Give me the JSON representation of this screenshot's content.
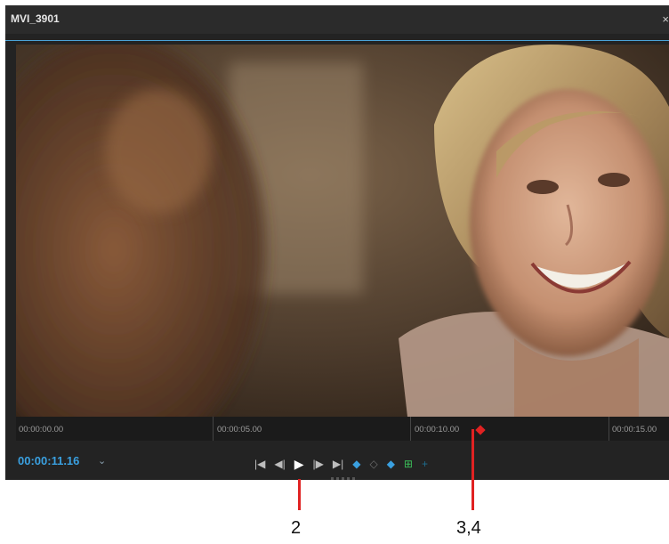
{
  "window": {
    "title": "MVI_3901",
    "close_glyph": "×"
  },
  "timeline": {
    "timecodes": [
      "00:00:00.00",
      "00:00:05.00",
      "00:00:10.00",
      "00:00:15.00"
    ],
    "playhead_color": "#e02222"
  },
  "transport": {
    "current_timecode": "00:00:11.16",
    "timecode_menu_glyph": "⌄",
    "buttons": [
      {
        "name": "go-to-in-icon",
        "glyph": "|◀"
      },
      {
        "name": "step-back-icon",
        "glyph": "◀|"
      },
      {
        "name": "play-icon",
        "glyph": "▶"
      },
      {
        "name": "step-forward-icon",
        "glyph": "|▶"
      },
      {
        "name": "go-to-out-icon",
        "glyph": "▶|"
      },
      {
        "name": "mark-in-icon",
        "glyph": "◆"
      },
      {
        "name": "clear-marker-icon",
        "glyph": "◇"
      },
      {
        "name": "mark-out-icon",
        "glyph": "◆"
      },
      {
        "name": "add-marker-icon",
        "glyph": "⊞"
      },
      {
        "name": "insert-icon",
        "glyph": "+"
      }
    ]
  },
  "annotations": [
    {
      "label": "2"
    },
    {
      "label": "3,4"
    }
  ],
  "colors": {
    "accent_blue": "#3aa0e0",
    "playhead_red": "#e02222",
    "marker_green": "#3bbf5a"
  }
}
